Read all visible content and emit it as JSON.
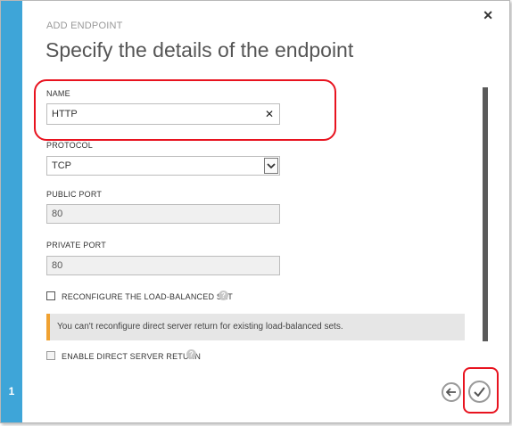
{
  "dialog": {
    "kicker": "ADD ENDPOINT",
    "title": "Specify the details of the endpoint",
    "step": "1"
  },
  "fields": {
    "name": {
      "label": "NAME",
      "value": "HTTP"
    },
    "protocol": {
      "label": "PROTOCOL",
      "value": "TCP"
    },
    "public_port": {
      "label": "PUBLIC PORT",
      "value": "80"
    },
    "private_port": {
      "label": "PRIVATE PORT",
      "value": "80"
    }
  },
  "options": {
    "reconfigure_lb": {
      "label": "RECONFIGURE THE LOAD-BALANCED SET",
      "checked": false
    },
    "direct_server_return": {
      "label": "ENABLE DIRECT SERVER RETURN",
      "checked": false
    }
  },
  "notice": "You can't reconfigure direct server return for existing load-balanced sets.",
  "icons": {
    "close": "close-icon",
    "clear": "clear-icon",
    "dropdown": "chevron-down-icon",
    "help": "help-icon",
    "back": "arrow-left-icon",
    "confirm": "checkmark-icon"
  },
  "colors": {
    "rail": "#3ea5d8",
    "notice_accent": "#f0a232",
    "highlight": "#e8131f"
  }
}
